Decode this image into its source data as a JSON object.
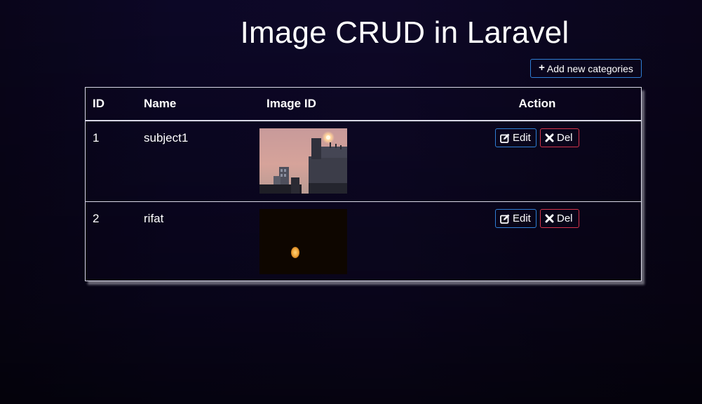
{
  "page": {
    "title": "Image CRUD in Laravel"
  },
  "toolbar": {
    "add_label": "Add new categories",
    "add_icon": "plus-icon"
  },
  "table": {
    "headers": [
      "ID",
      "Name",
      "Image ID",
      "Action"
    ],
    "rows": [
      {
        "id": "1",
        "name": "subject1",
        "image": "sunset-buildings-photo",
        "edit_label": "Edit",
        "del_label": "Del"
      },
      {
        "id": "2",
        "name": "rifat",
        "image": "moon-night-photo",
        "edit_label": "Edit",
        "del_label": "Del"
      }
    ]
  },
  "icons": {
    "edit": "edit-icon",
    "delete": "close-icon"
  },
  "colors": {
    "primary_border": "#2f7fd6",
    "danger_border": "#d4334a",
    "table_border": "#d9d9e6",
    "background": "#0c0726"
  }
}
